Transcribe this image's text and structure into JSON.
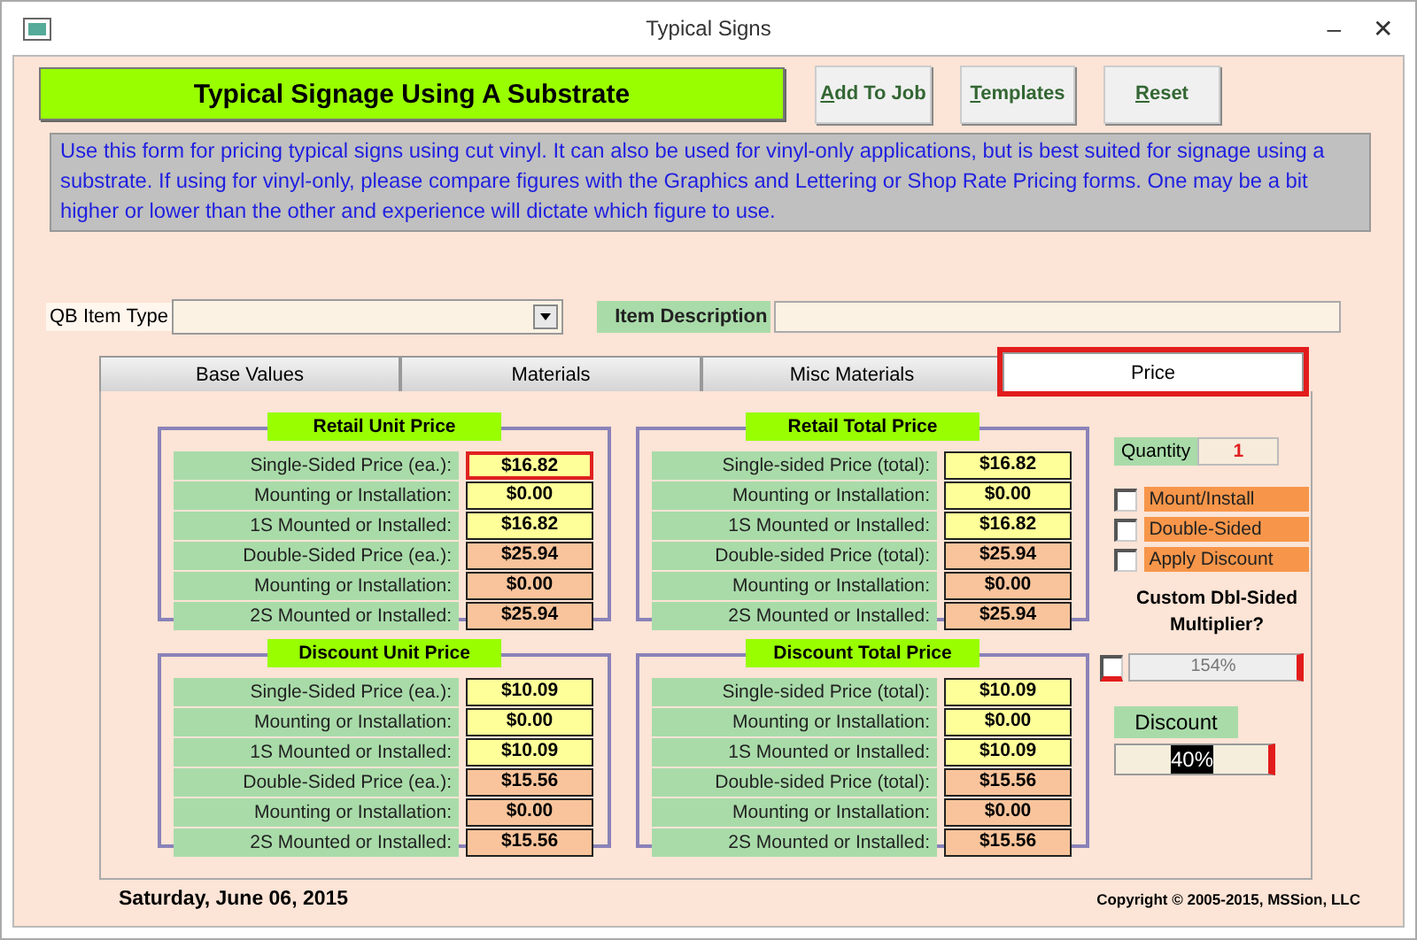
{
  "window": {
    "title": "Typical Signs",
    "controls": [
      "–",
      "✕"
    ]
  },
  "header": {
    "title": "Typical Signage Using A Substrate"
  },
  "buttons": [
    {
      "key": "A",
      "rest": "dd To Job"
    },
    {
      "key": "T",
      "rest": "emplates"
    },
    {
      "key": "R",
      "rest": "eset"
    }
  ],
  "description": "Use this form for pricing typical signs using cut vinyl.  It can also be used for vinyl-only applications, but is best suited for signage using a substrate.  If using for vinyl-only, please compare figures with the Graphics and Lettering or Shop Rate Pricing forms.  One may be a bit higher or lower than the other and experience will dictate which figure to use.",
  "qb_item_type": {
    "label": "QB Item Type"
  },
  "item_description": {
    "label": "Item Description"
  },
  "tabs": [
    {
      "label": "Base Values",
      "selected": false,
      "highlighted": false
    },
    {
      "label": "Materials",
      "selected": false,
      "highlighted": false
    },
    {
      "label": "Misc Materials",
      "selected": false,
      "highlighted": false
    },
    {
      "label": "Price",
      "selected": true,
      "highlighted": true
    }
  ],
  "groups": [
    {
      "title": "Retail Unit Price",
      "rows": [
        {
          "label": "Single-Sided Price (ea.):",
          "value": "$16.82",
          "kind": "single",
          "focused": true
        },
        {
          "label": "Mounting or Installation:",
          "value": "$0.00",
          "kind": "single",
          "focused": false
        },
        {
          "label": "1S Mounted or Installed:",
          "value": "$16.82",
          "kind": "single",
          "focused": false
        },
        {
          "label": "Double-Sided Price (ea.):",
          "value": "$25.94",
          "kind": "double",
          "focused": false
        },
        {
          "label": "Mounting or Installation:",
          "value": "$0.00",
          "kind": "double",
          "focused": false
        },
        {
          "label": "2S Mounted or Installed:",
          "value": "$25.94",
          "kind": "double",
          "focused": false
        }
      ]
    },
    {
      "title": "Retail Total Price",
      "rows": [
        {
          "label": "Single-sided Price (total):",
          "value": "$16.82",
          "kind": "single",
          "focused": false
        },
        {
          "label": "Mounting or Installation:",
          "value": "$0.00",
          "kind": "single",
          "focused": false
        },
        {
          "label": "1S Mounted or Installed:",
          "value": "$16.82",
          "kind": "single",
          "focused": false
        },
        {
          "label": "Double-sided Price (total):",
          "value": "$25.94",
          "kind": "double",
          "focused": false
        },
        {
          "label": "Mounting or Installation:",
          "value": "$0.00",
          "kind": "double",
          "focused": false
        },
        {
          "label": "2S Mounted or Installed:",
          "value": "$25.94",
          "kind": "double",
          "focused": false
        }
      ]
    },
    {
      "title": "Discount Unit Price",
      "rows": [
        {
          "label": "Single-Sided Price (ea.):",
          "value": "$10.09",
          "kind": "single",
          "focused": false
        },
        {
          "label": "Mounting or Installation:",
          "value": "$0.00",
          "kind": "single",
          "focused": false
        },
        {
          "label": "1S Mounted or Installed:",
          "value": "$10.09",
          "kind": "single",
          "focused": false
        },
        {
          "label": "Double-Sided Price (ea.):",
          "value": "$15.56",
          "kind": "double",
          "focused": false
        },
        {
          "label": "Mounting or Installation:",
          "value": "$0.00",
          "kind": "double",
          "focused": false
        },
        {
          "label": "2S Mounted or Installed:",
          "value": "$15.56",
          "kind": "double",
          "focused": false
        }
      ]
    },
    {
      "title": "Discount Total Price",
      "rows": [
        {
          "label": "Single-sided Price (total):",
          "value": "$10.09",
          "kind": "single",
          "focused": false
        },
        {
          "label": "Mounting or Installation:",
          "value": "$0.00",
          "kind": "single",
          "focused": false
        },
        {
          "label": "1S Mounted or Installed:",
          "value": "$10.09",
          "kind": "single",
          "focused": false
        },
        {
          "label": "Double-sided Price (total):",
          "value": "$15.56",
          "kind": "double",
          "focused": false
        },
        {
          "label": "Mounting or Installation:",
          "value": "$0.00",
          "kind": "double",
          "focused": false
        },
        {
          "label": "2S Mounted or Installed:",
          "value": "$15.56",
          "kind": "double",
          "focused": false
        }
      ]
    }
  ],
  "quantity": {
    "label": "Quantity",
    "value": "1"
  },
  "options": [
    {
      "label": "Mount/Install",
      "checked": false
    },
    {
      "label": "Double-Sided",
      "checked": false
    },
    {
      "label": "Apply Discount",
      "checked": false
    }
  ],
  "multiplier": {
    "label": "Custom Dbl-Sided Multiplier?",
    "checked": false,
    "value": "154%"
  },
  "discount": {
    "label": "Discount",
    "value": "40%"
  },
  "footer": {
    "date": "Saturday, June 06, 2015",
    "copyright": "Copyright © 2005-2015, MSSion, LLC"
  }
}
